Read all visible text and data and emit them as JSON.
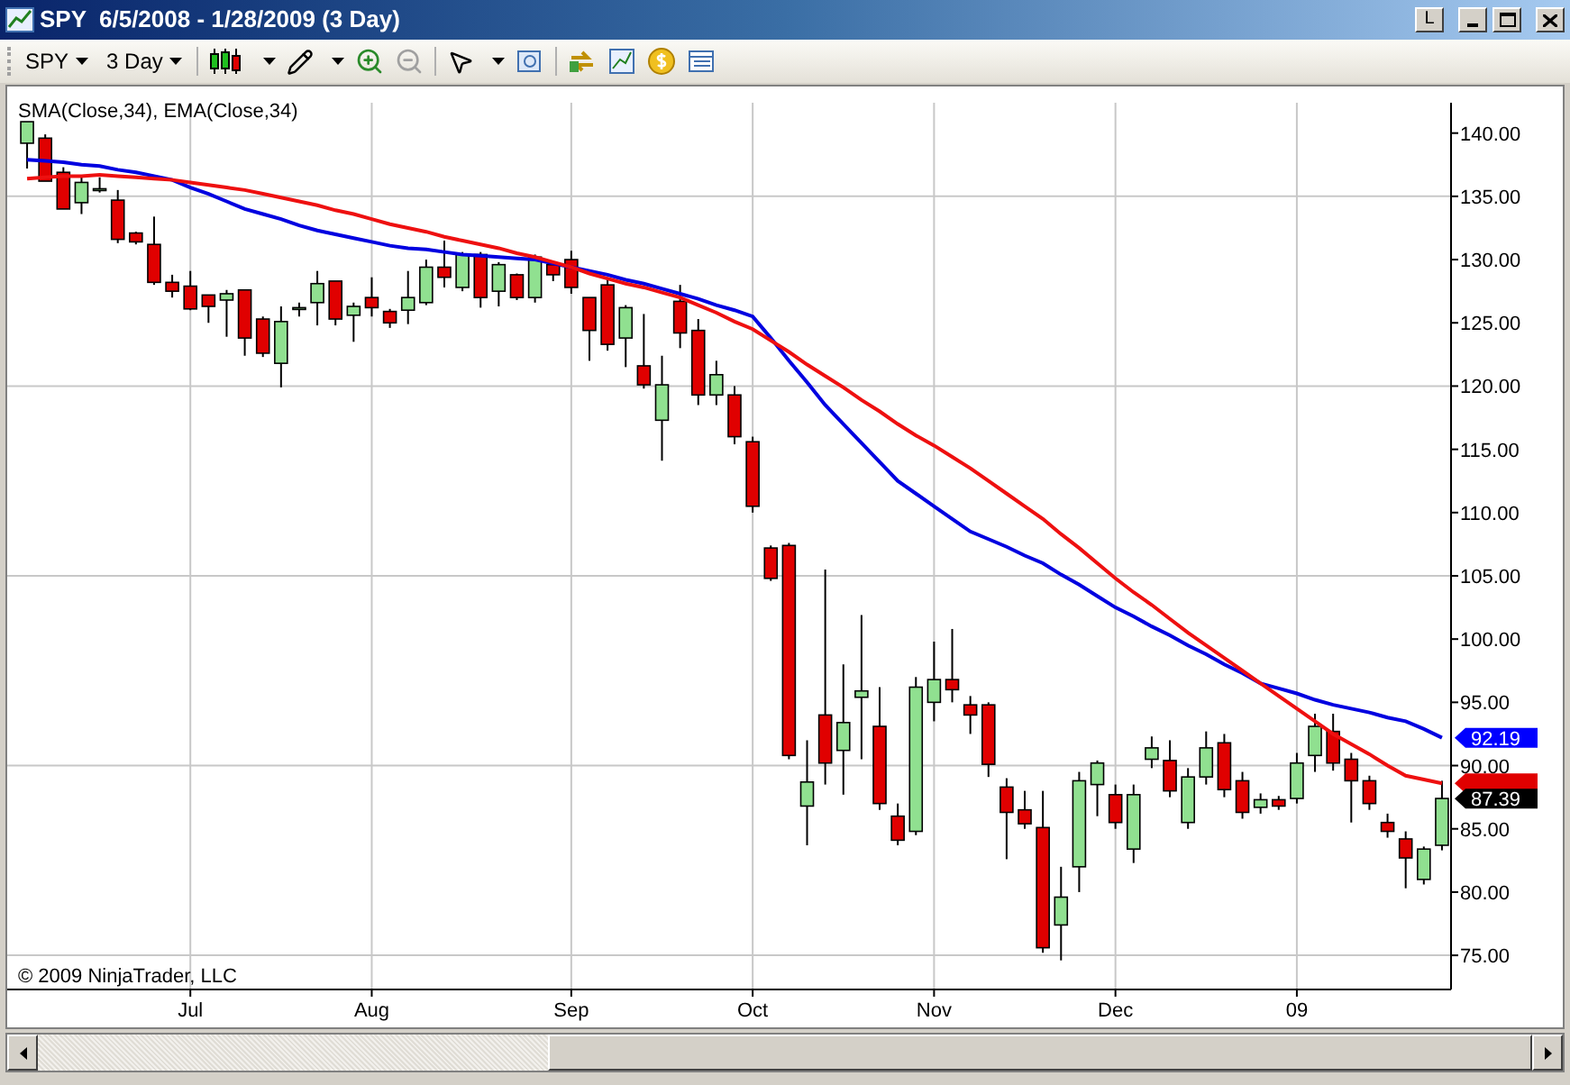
{
  "window": {
    "title": "SPY  6/5/2008 - 1/28/2009 (3 Day)",
    "lock_button": "L"
  },
  "toolbar": {
    "instrument": "SPY",
    "period": "3 Day"
  },
  "chart": {
    "copyright": "© 2009 NinjaTrader, LLC",
    "price_tags": [
      {
        "text": "92.19",
        "color": "#0000ff"
      },
      {
        "color": "#e00000"
      },
      {
        "text": "87.39",
        "color": "#000000"
      }
    ],
    "legend_separator": ", ",
    "chart_data": {
      "type": "candlestick",
      "categories": [
        null,
        null,
        null,
        null,
        null,
        null,
        null,
        null,
        null,
        "Jul",
        null,
        null,
        null,
        null,
        null,
        null,
        null,
        null,
        null,
        "Aug",
        null,
        null,
        null,
        null,
        null,
        null,
        null,
        null,
        null,
        null,
        "Sep",
        null,
        null,
        null,
        null,
        null,
        null,
        null,
        null,
        null,
        "Oct",
        null,
        null,
        null,
        null,
        null,
        null,
        null,
        null,
        null,
        "Nov",
        null,
        null,
        null,
        null,
        null,
        null,
        null,
        null,
        null,
        "Dec",
        null,
        null,
        null,
        null,
        null,
        null,
        null,
        null,
        null,
        "09",
        null,
        null,
        null,
        null,
        null,
        null,
        null,
        null
      ],
      "series": [
        {
          "name": "SMA(Close,34)",
          "type": "line",
          "color": "#0000e0",
          "values": [
            137.9,
            137.8,
            137.7,
            137.5,
            137.4,
            137.1,
            136.9,
            136.6,
            136.3,
            135.7,
            135.2,
            134.6,
            134,
            133.6,
            133.2,
            132.7,
            132.3,
            132,
            131.7,
            131.4,
            131.1,
            130.9,
            130.8,
            130.6,
            130.4,
            130.3,
            130.2,
            130.1,
            130,
            129.7,
            129.4,
            129.1,
            128.8,
            128.4,
            128.1,
            127.7,
            127.3,
            126.9,
            126.4,
            126,
            125.5,
            123.8,
            122,
            120.3,
            118.5,
            117,
            115.5,
            114,
            112.5,
            111.5,
            110.5,
            109.5,
            108.5,
            107.9,
            107.3,
            106.6,
            106,
            105.1,
            104.3,
            103.4,
            102.5,
            101.8,
            101,
            100.3,
            99.5,
            98.8,
            98,
            97.3,
            96.5,
            96.1,
            95.7,
            95.2,
            94.8,
            94.5,
            94.2,
            93.8,
            93.5,
            92.9,
            92.2
          ]
        },
        {
          "name": "EMA(Close,34)",
          "type": "line",
          "color": "#ee1010",
          "values": [
            136.4,
            136.5,
            136.6,
            136.6,
            136.7,
            136.6,
            136.5,
            136.4,
            136.3,
            136.1,
            135.9,
            135.7,
            135.5,
            135.2,
            134.9,
            134.6,
            134.3,
            133.9,
            133.6,
            133.2,
            132.8,
            132.5,
            132.2,
            131.8,
            131.5,
            131.2,
            130.9,
            130.5,
            130.2,
            129.8,
            129.4,
            128.9,
            128.5,
            128.1,
            127.8,
            127.4,
            127,
            126.4,
            125.8,
            125.1,
            124.5,
            123.6,
            122.7,
            121.7,
            120.8,
            119.9,
            118.9,
            118,
            117,
            116.1,
            115.3,
            114.4,
            113.5,
            112.5,
            111.5,
            110.5,
            109.5,
            108.3,
            107.2,
            106,
            104.8,
            103.7,
            102.7,
            101.6,
            100.5,
            99.5,
            98.5,
            97.5,
            96.5,
            95.5,
            94.5,
            93.5,
            92.5,
            91.7,
            90.9,
            90,
            89.2,
            88.9,
            88.6
          ]
        }
      ],
      "ohlc": [
        [
          139.2,
          140.9,
          137.2,
          140.9
        ],
        [
          139.6,
          139.9,
          136.2,
          136.2
        ],
        [
          136.9,
          137.3,
          134,
          134
        ],
        [
          134.5,
          136.6,
          133.6,
          136.1
        ],
        [
          135.6,
          136.5,
          135.3,
          135.6
        ],
        [
          134.7,
          135.5,
          131.3,
          131.6
        ],
        [
          132.1,
          132.2,
          131.2,
          131.4
        ],
        [
          131.2,
          133.4,
          128,
          128.2
        ],
        [
          128.2,
          128.8,
          127,
          127.5
        ],
        [
          127.9,
          129.1,
          126,
          126.1
        ],
        [
          127.2,
          127.2,
          125,
          126.3
        ],
        [
          126.8,
          127.6,
          123.9,
          127.3
        ],
        [
          127.6,
          127.6,
          122.4,
          123.8
        ],
        [
          125.3,
          125.5,
          122.3,
          122.6
        ],
        [
          121.8,
          126.3,
          119.9,
          125.1
        ],
        [
          126.2,
          126.6,
          125.5,
          126.2
        ],
        [
          126.6,
          129.1,
          124.8,
          128.1
        ],
        [
          128.3,
          128.3,
          124.8,
          125.3
        ],
        [
          125.6,
          126.6,
          123.5,
          126.3
        ],
        [
          127,
          128.6,
          125.5,
          126.2
        ],
        [
          125.9,
          126.1,
          124.6,
          125
        ],
        [
          126,
          129.1,
          124.9,
          127
        ],
        [
          126.6,
          130,
          126.4,
          129.4
        ],
        [
          129.4,
          131.5,
          127.8,
          128.6
        ],
        [
          127.8,
          130.6,
          127.5,
          130.4
        ],
        [
          130.4,
          130.6,
          126.2,
          127
        ],
        [
          127.5,
          129.8,
          126.3,
          129.6
        ],
        [
          128.8,
          128.9,
          126.8,
          127
        ],
        [
          127,
          130.4,
          126.6,
          130.2
        ],
        [
          129.6,
          129.7,
          128.3,
          128.8
        ],
        [
          130,
          130.7,
          127.3,
          127.8
        ],
        [
          127,
          127,
          122,
          124.4
        ],
        [
          128,
          128.4,
          122.8,
          123.3
        ],
        [
          123.8,
          126.4,
          121.5,
          126.2
        ],
        [
          121.6,
          125.7,
          119.8,
          120.1
        ],
        [
          117.3,
          122.4,
          114.1,
          120.1
        ],
        [
          126.7,
          128,
          123,
          124.2
        ],
        [
          124.4,
          125.3,
          118.5,
          119.3
        ],
        [
          119.3,
          122,
          118.5,
          120.9
        ],
        [
          119.3,
          120,
          115.4,
          116
        ],
        [
          115.6,
          116,
          110,
          110.5
        ],
        [
          107.2,
          107.4,
          104.6,
          104.8
        ],
        [
          107.4,
          107.6,
          90.5,
          90.8
        ],
        [
          86.8,
          92,
          83.7,
          88.7
        ],
        [
          94,
          105.5,
          88.5,
          90.2
        ],
        [
          91.2,
          98,
          87.7,
          93.4
        ],
        [
          95.4,
          101.9,
          90.5,
          95.9
        ],
        [
          93.1,
          96.2,
          86.5,
          87
        ],
        [
          86,
          87,
          83.7,
          84.1
        ],
        [
          84.8,
          97,
          84.5,
          96.2
        ],
        [
          95,
          99.8,
          93.5,
          96.8
        ],
        [
          96.8,
          100.8,
          95,
          96
        ],
        [
          94.8,
          95.5,
          92.5,
          94
        ],
        [
          94.8,
          95,
          89.1,
          90.1
        ],
        [
          88.3,
          89,
          82.6,
          86.3
        ],
        [
          86.5,
          88,
          85,
          85.4
        ],
        [
          85.1,
          88,
          75.2,
          75.6
        ],
        [
          77.4,
          82,
          74.6,
          79.6
        ],
        [
          82,
          89.5,
          80,
          88.8
        ],
        [
          88.5,
          90.4,
          86,
          90.2
        ],
        [
          87.7,
          88.5,
          85,
          85.5
        ],
        [
          83.4,
          88.5,
          82.3,
          87.7
        ],
        [
          90.5,
          92.3,
          89.8,
          91.4
        ],
        [
          90.4,
          92,
          87.5,
          88
        ],
        [
          85.5,
          89.8,
          85,
          89.1
        ],
        [
          89.1,
          92.7,
          88.5,
          91.4
        ],
        [
          91.8,
          92.5,
          87.5,
          88.1
        ],
        [
          88.8,
          89.5,
          85.8,
          86.3
        ],
        [
          86.7,
          87.8,
          86.2,
          87.3
        ],
        [
          87.3,
          87.6,
          86.5,
          86.8
        ],
        [
          87.4,
          91,
          87,
          90.2
        ],
        [
          90.8,
          94.1,
          89.5,
          93.1
        ],
        [
          92.7,
          94.1,
          89.6,
          90.2
        ],
        [
          90.5,
          91,
          85.5,
          88.8
        ],
        [
          88.8,
          89.2,
          86.5,
          87
        ],
        [
          85.5,
          86.2,
          84.3,
          84.8
        ],
        [
          84.2,
          84.8,
          80.3,
          82.7
        ],
        [
          81,
          83.6,
          80.6,
          83.4
        ],
        [
          83.7,
          88.8,
          83.3,
          87.4
        ]
      ],
      "ylim": [
        72.3,
        142.4
      ],
      "grid": true,
      "yticks": [
        {
          "value": 140,
          "label": "140.00"
        },
        {
          "value": 135,
          "label": "135.00"
        },
        {
          "value": 130,
          "label": "130.00"
        },
        {
          "value": 125,
          "label": "125.00"
        },
        {
          "value": 120,
          "label": "120.00"
        },
        {
          "value": 115,
          "label": "115.00"
        },
        {
          "value": 110,
          "label": "110.00"
        },
        {
          "value": 105,
          "label": "105.00"
        },
        {
          "value": 100,
          "label": "100.00"
        },
        {
          "value": 95,
          "label": "95.00"
        },
        {
          "value": 90,
          "label": "90.00"
        },
        {
          "value": 85,
          "label": "85.00"
        },
        {
          "value": 80,
          "label": "80.00"
        },
        {
          "value": 75,
          "label": "75.00"
        }
      ]
    }
  }
}
